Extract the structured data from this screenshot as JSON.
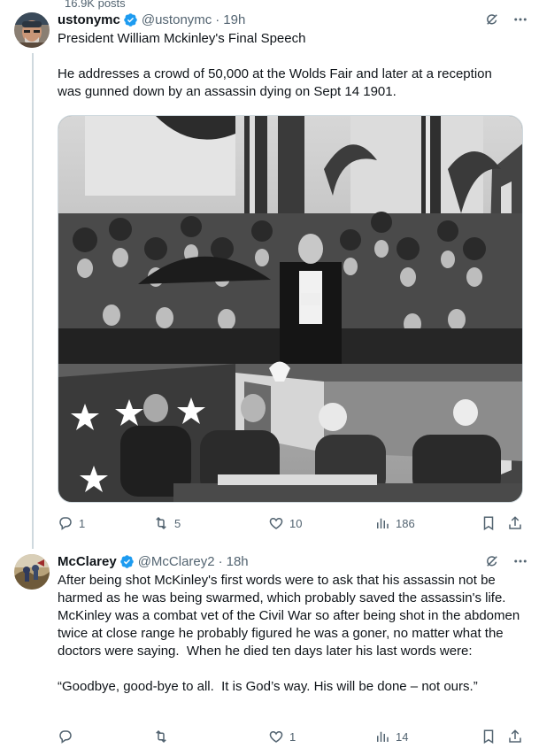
{
  "top_fragment": "16.9K posts",
  "posts": [
    {
      "name": "ustonymc",
      "handle": "@ustonymc",
      "time": "19h",
      "text": "President William Mckinley's Final Speech\n\nHe addresses a crowd of 50,000 at the Wolds Fair and later at a reception was gunned down by an assassin dying on Sept 14 1901.",
      "replies": "1",
      "reposts": "5",
      "likes": "10",
      "views": "186"
    },
    {
      "name": "McClarey",
      "handle": "@McClarey2",
      "time": "18h",
      "text": "After being shot McKinley's first words were to ask that his assassin not be harmed as he was being swarmed, which probably saved the assassin's life. McKinley was a combat vet of the Civil War so after being shot in the abdomen twice at close range he probably figured he was a goner, no matter what the doctors were saying.  When he died ten days later his last words were:\n\n“Goodbye, good-bye to all.  It is God’s way. His will be done – not ours.”",
      "replies": "",
      "reposts": "",
      "likes": "1",
      "views": "14"
    }
  ],
  "separator": "·",
  "colors": {
    "text": "#0f1419",
    "muted": "#536471",
    "verified": "#1d9bf0",
    "line": "#cfd9de"
  },
  "icons": [
    "verified-badge-icon",
    "grok-icon",
    "more-icon",
    "reply-icon",
    "repost-icon",
    "like-icon",
    "views-icon",
    "bookmark-icon",
    "share-icon"
  ]
}
